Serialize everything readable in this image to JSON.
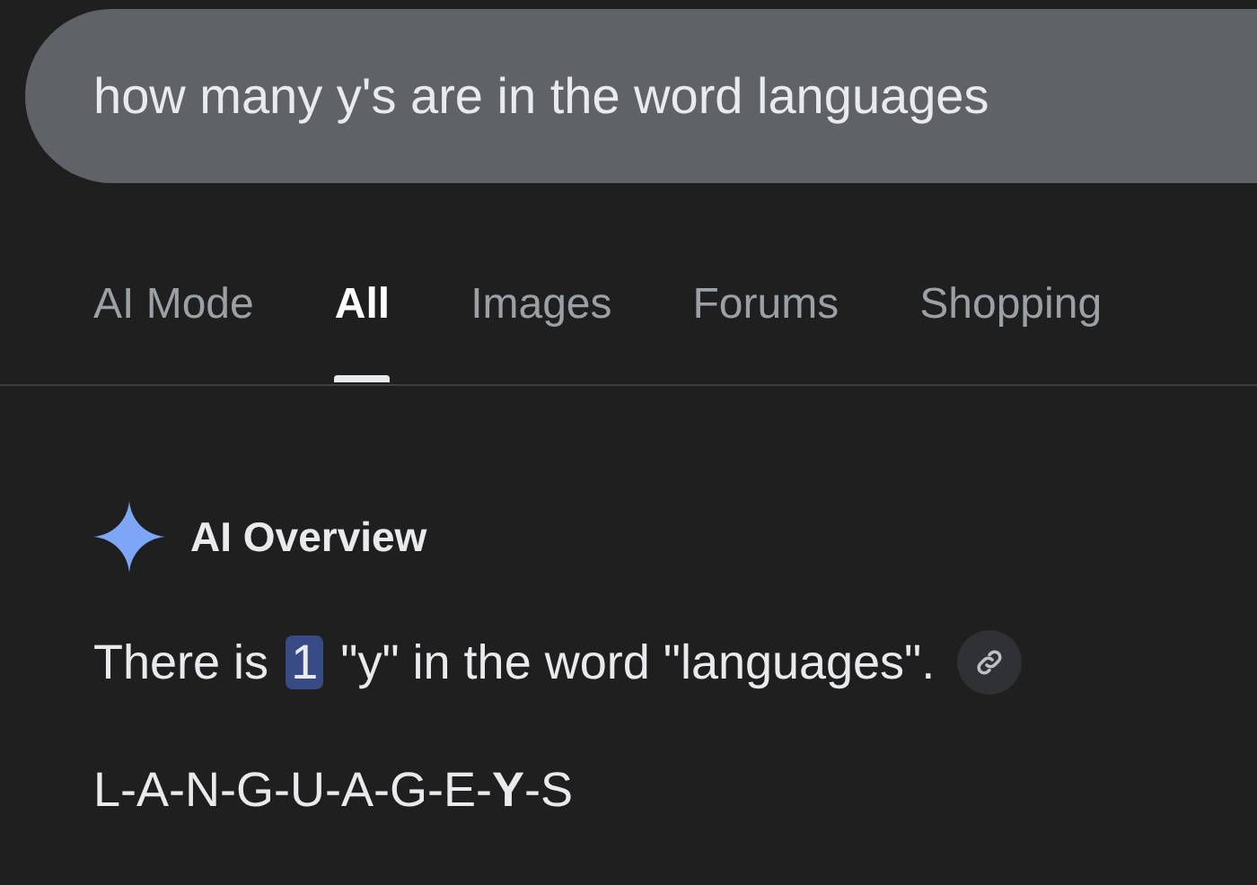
{
  "search": {
    "value": "how many y's are in the word languages"
  },
  "tabs": [
    {
      "label": "AI Mode",
      "selected": false
    },
    {
      "label": "All",
      "selected": true
    },
    {
      "label": "Images",
      "selected": false
    },
    {
      "label": "Forums",
      "selected": false
    },
    {
      "label": "Shopping",
      "selected": false
    }
  ],
  "overview": {
    "title": "AI Overview",
    "answer": {
      "before": "There is",
      "highlight": "1",
      "after": "\"y\" in the word \"languages\"."
    },
    "spelling": "L-A-N-G-U-A-G-E-**Y**-S"
  }
}
